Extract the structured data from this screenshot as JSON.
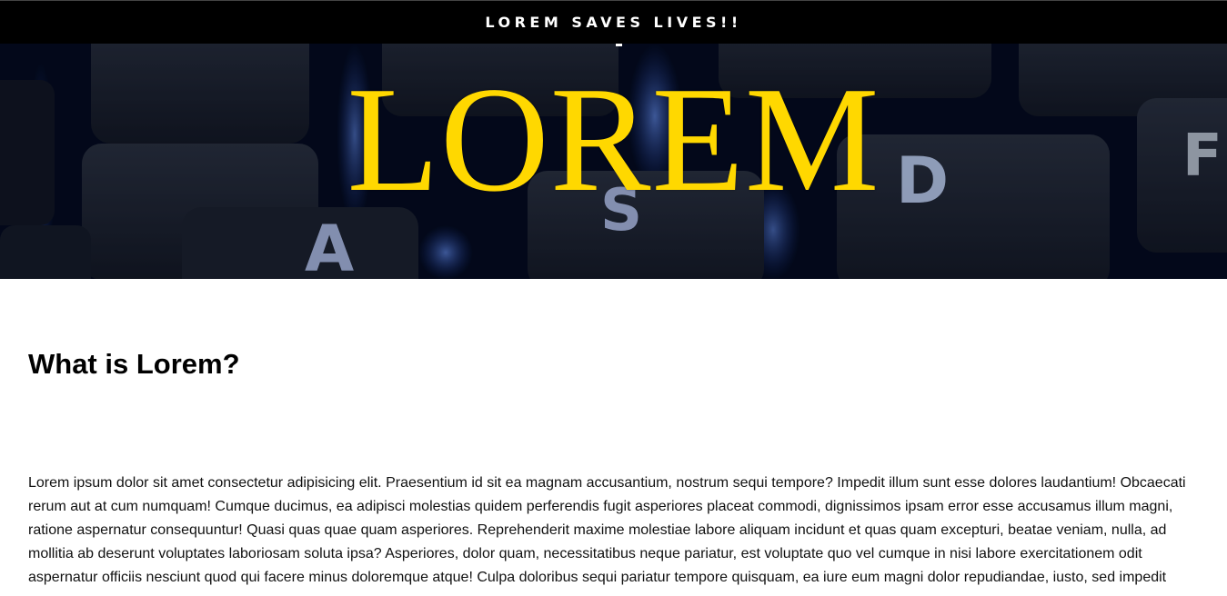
{
  "topbar": {
    "title": "LOREM SAVES LIVES!!"
  },
  "hero": {
    "title": "LOREM",
    "background_keys": [
      "A",
      "S",
      "D",
      "F"
    ],
    "title_color": "#ffd800",
    "background_color": "#050b1e",
    "key_glow_color": "#4d7fff"
  },
  "section": {
    "heading": "What is Lorem?",
    "paragraph": "Lorem ipsum dolor sit amet consectetur adipisicing elit. Praesentium id sit ea magnam accusantium, nostrum sequi tempore? Impedit illum sunt esse dolores laudantium! Obcaecati rerum aut at cum numquam! Cumque ducimus, ea adipisci molestias quidem perferendis fugit asperiores placeat commodi, dignissimos ipsam error esse accusamus illum magni, ratione aspernatur consequuntur! Quasi quas quae quam asperiores. Reprehenderit maxime molestiae labore aliquam incidunt et quas quam excepturi, beatae veniam, nulla, ad mollitia ab deserunt voluptates laboriosam soluta ipsa? Asperiores, dolor quam, necessitatibus neque pariatur, est voluptate quo vel cumque in nisi labore exercitationem odit aspernatur officiis nesciunt quod qui facere minus doloremque atque! Culpa doloribus sequi pariatur tempore quisquam, ea iure eum magni dolor repudiandae, iusto, sed impedit"
  }
}
